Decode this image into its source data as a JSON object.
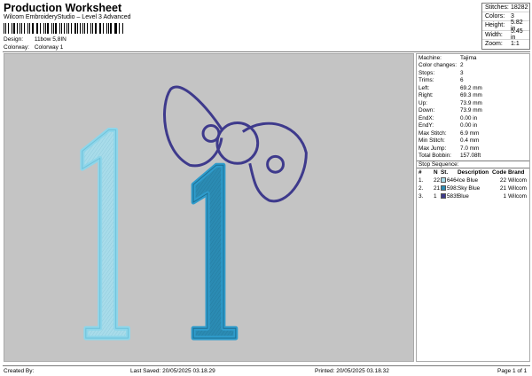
{
  "header": {
    "title": "Production Worksheet",
    "subtitle": "Wilcom EmbroideryStudio – Level 3 Advanced"
  },
  "design": {
    "label": "Design:",
    "value": "11bow 5,8IN"
  },
  "colorway": {
    "label": "Colorway:",
    "value": "Colorway 1"
  },
  "summary": [
    {
      "label": "Stitches:",
      "value": "18282"
    },
    {
      "label": "Colors:",
      "value": "3"
    },
    {
      "label": "Height:",
      "value": "5.82 in"
    },
    {
      "label": "Width:",
      "value": "5.45 in"
    },
    {
      "label": "Zoom:",
      "value": "1:1"
    }
  ],
  "machine_info": [
    {
      "label": "Machine:",
      "value": "Tajima"
    },
    {
      "label": "Color changes:",
      "value": "2"
    },
    {
      "label": "Stops:",
      "value": "3"
    },
    {
      "label": "Trims:",
      "value": "6"
    },
    {
      "label": "Left:",
      "value": "69.2 mm"
    },
    {
      "label": "Right:",
      "value": "69.3 mm"
    },
    {
      "label": "Up:",
      "value": "73.9 mm"
    },
    {
      "label": "Down:",
      "value": "73.9 mm"
    },
    {
      "label": "EndX:",
      "value": "0.00 in"
    },
    {
      "label": "EndY:",
      "value": "0.00 in"
    },
    {
      "label": "Max Stitch:",
      "value": "6.9 mm"
    },
    {
      "label": "Min Stitch:",
      "value": "0.4 mm"
    },
    {
      "label": "Max Jump:",
      "value": "7.0 mm"
    },
    {
      "label": "Total Bobbin:",
      "value": "157.08ft"
    }
  ],
  "stop_sequence": {
    "title": "Stop Sequence:",
    "columns": [
      "#",
      "N",
      "St.",
      "Description",
      "Code",
      "Brand"
    ],
    "rows": [
      {
        "num": "1.",
        "needle": "22",
        "code_swatch": "6464",
        "color": "#a8dcea",
        "description": "Ice Blue",
        "code": "22",
        "brand": "Wilcom"
      },
      {
        "num": "2.",
        "needle": "21",
        "code_swatch": "5981",
        "color": "#2b8bb3",
        "description": "Sky Blue",
        "code": "21",
        "brand": "Wilcom"
      },
      {
        "num": "3.",
        "needle": "1",
        "code_swatch": "5835",
        "color": "#3e3a8c",
        "description": "Blue",
        "code": "1",
        "brand": "Wilcom"
      }
    ]
  },
  "footer": {
    "created_by": "Created By:",
    "last_saved": "Last Saved: 20/05/2025 03.18.29",
    "printed": "Printed: 20/05/2025 03.18.32",
    "page": "Page 1 of 1"
  },
  "colors": {
    "ice_blue": "#a8dcea",
    "sky_blue": "#2b8bb3",
    "bow_blue": "#3e3a8c",
    "canvas_bg": "#c4c4c4"
  }
}
